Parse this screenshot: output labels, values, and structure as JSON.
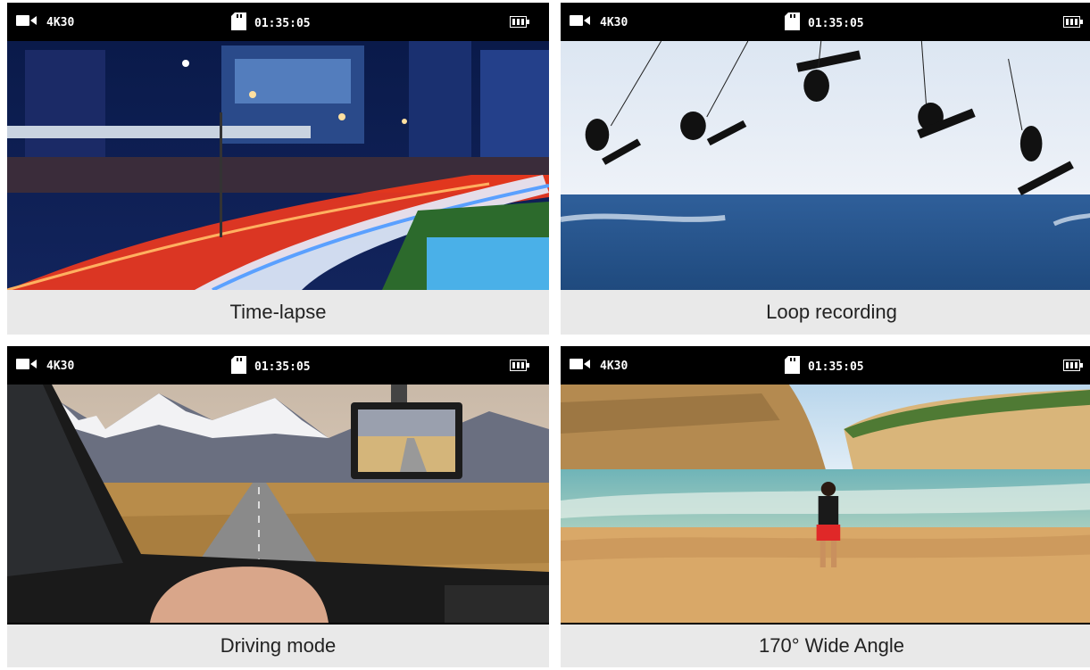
{
  "status_bar": {
    "resolution": "4K30",
    "time": "01:35:05",
    "icons": [
      "video-camera-icon",
      "sd-card-icon",
      "battery-icon"
    ]
  },
  "panels": [
    {
      "caption": "Time-lapse"
    },
    {
      "caption": "Loop recording"
    },
    {
      "caption": "Driving mode"
    },
    {
      "caption": "170° Wide Angle"
    }
  ],
  "colors": {
    "status_bar_bg": "#000000",
    "caption_bg": "#f2f2f2",
    "caption_text": "#222222"
  }
}
